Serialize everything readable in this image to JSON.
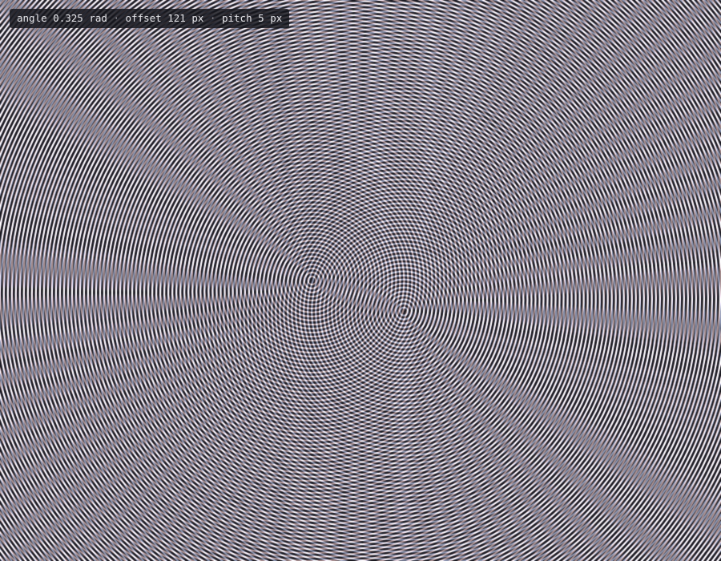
{
  "readout": {
    "angle_label": "angle",
    "angle_value": "0.325",
    "angle_unit": "rad",
    "offset_label": "offset",
    "offset_value": "121",
    "offset_unit": "px",
    "pitch_label": "pitch",
    "pitch_value": "5",
    "pitch_unit": "px",
    "separator": "·"
  },
  "pattern": {
    "angle": 0.325,
    "offset": 121,
    "pitch": 5,
    "background_color": "#1c1b22",
    "ring_color_a": "#e8c2b8",
    "ring_color_b": "#b8c8e8"
  }
}
